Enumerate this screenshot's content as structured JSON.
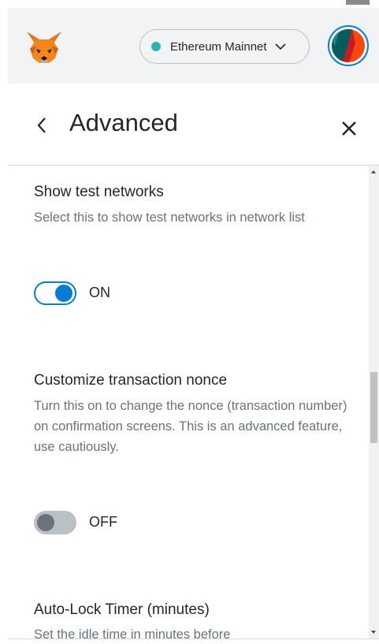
{
  "header": {
    "logo_icon": "metamask-fox-icon",
    "network": {
      "label": "Ethereum Mainnet",
      "dot_color": "#29b6af"
    },
    "avatar_icon": "account-identicon"
  },
  "titlebar": {
    "title": "Advanced",
    "back_icon": "chevron-left-icon",
    "close_icon": "close-icon"
  },
  "settings": [
    {
      "title": "Show test networks",
      "description": "Select this to show test networks in network list",
      "toggle": {
        "on": true,
        "label": "ON"
      }
    },
    {
      "title": "Customize transaction nonce",
      "description": "Turn this on to change the nonce (transaction number) on confirmation screens. This is an advanced feature, use cautiously.",
      "toggle": {
        "on": false,
        "label": "OFF"
      }
    },
    {
      "title": "Auto-Lock Timer (minutes)",
      "description": "Set the idle time in minutes before"
    }
  ],
  "colors": {
    "accent": "#037dd6",
    "header_bg": "#f2f3f4",
    "muted_text": "#6a737d"
  }
}
